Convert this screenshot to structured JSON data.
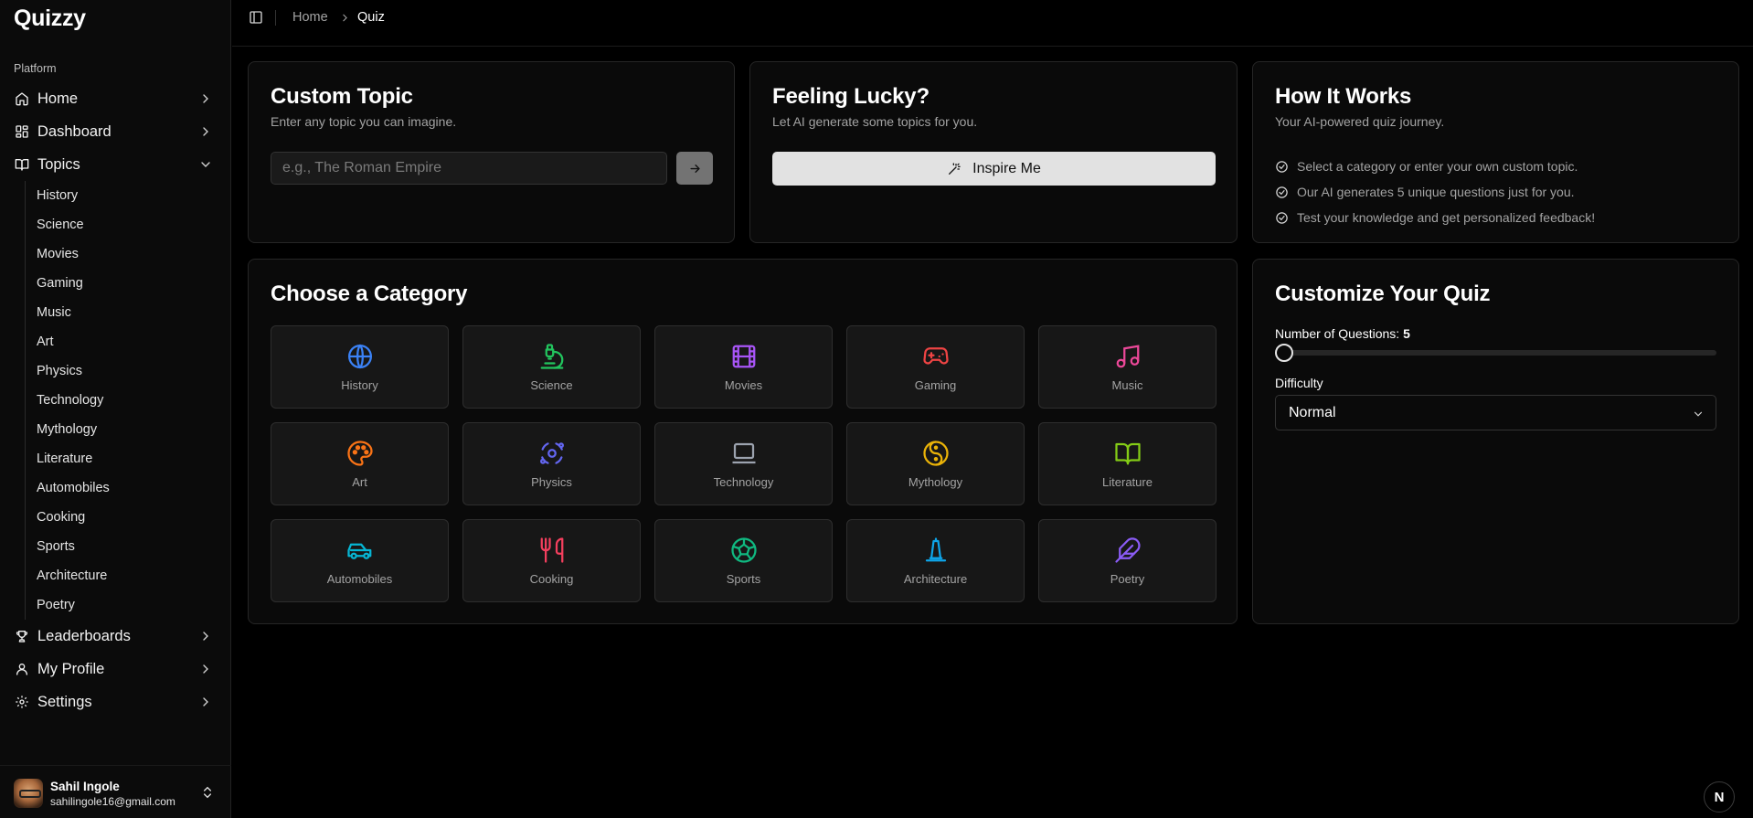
{
  "app": {
    "name": "Quizzy"
  },
  "sidebar": {
    "group_label": "Platform",
    "items": [
      {
        "label": "Home",
        "icon": "home-icon"
      },
      {
        "label": "Dashboard",
        "icon": "dashboard-icon"
      },
      {
        "label": "Topics",
        "icon": "book-open-icon",
        "expanded": true
      },
      {
        "label": "Leaderboards",
        "icon": "trophy-icon"
      },
      {
        "label": "My Profile",
        "icon": "user-icon"
      },
      {
        "label": "Settings",
        "icon": "gear-icon"
      }
    ],
    "topics": [
      "History",
      "Science",
      "Movies",
      "Gaming",
      "Music",
      "Art",
      "Physics",
      "Technology",
      "Mythology",
      "Literature",
      "Automobiles",
      "Cooking",
      "Sports",
      "Architecture",
      "Poetry"
    ],
    "user": {
      "name": "Sahil Ingole",
      "email": "sahilingole16@gmail.com"
    }
  },
  "breadcrumb": {
    "home": "Home",
    "current": "Quiz"
  },
  "custom_topic": {
    "title": "Custom Topic",
    "subtitle": "Enter any topic you can imagine.",
    "placeholder": "e.g., The Roman Empire",
    "value": ""
  },
  "lucky": {
    "title": "Feeling Lucky?",
    "subtitle": "Let AI generate some topics for you.",
    "button": "Inspire Me"
  },
  "how": {
    "title": "How It Works",
    "subtitle": "Your AI-powered quiz journey.",
    "steps": [
      "Select a category or enter your own custom topic.",
      "Our AI generates 5 unique questions just for you.",
      "Test your knowledge and get personalized feedback!"
    ]
  },
  "categories": {
    "title": "Choose a Category",
    "items": [
      {
        "label": "History",
        "icon": "globe-icon",
        "color": "#3b82f6"
      },
      {
        "label": "Science",
        "icon": "microscope-icon",
        "color": "#22c55e"
      },
      {
        "label": "Movies",
        "icon": "film-icon",
        "color": "#a855f7"
      },
      {
        "label": "Gaming",
        "icon": "gamepad-icon",
        "color": "#ef4444"
      },
      {
        "label": "Music",
        "icon": "music-icon",
        "color": "#ec4899"
      },
      {
        "label": "Art",
        "icon": "palette-icon",
        "color": "#f97316"
      },
      {
        "label": "Physics",
        "icon": "orbit-icon",
        "color": "#6366f1"
      },
      {
        "label": "Technology",
        "icon": "laptop-icon",
        "color": "#9ca3af"
      },
      {
        "label": "Mythology",
        "icon": "yin-yang-icon",
        "color": "#eab308"
      },
      {
        "label": "Literature",
        "icon": "book-icon",
        "color": "#84cc16"
      },
      {
        "label": "Automobiles",
        "icon": "car-icon",
        "color": "#06b6d4"
      },
      {
        "label": "Cooking",
        "icon": "utensils-icon",
        "color": "#f43f5e"
      },
      {
        "label": "Sports",
        "icon": "soccer-ball-icon",
        "color": "#10b981"
      },
      {
        "label": "Architecture",
        "icon": "landmark-icon",
        "color": "#0ea5e9"
      },
      {
        "label": "Poetry",
        "icon": "feather-icon",
        "color": "#8b5cf6"
      }
    ]
  },
  "customize": {
    "title": "Customize Your Quiz",
    "questions_label": "Number of Questions:",
    "questions_value": "5",
    "slider_fraction": 0,
    "difficulty_label": "Difficulty",
    "difficulty_value": "Normal"
  },
  "fab": {
    "label": "N",
    "icon": "next-logo-icon"
  }
}
